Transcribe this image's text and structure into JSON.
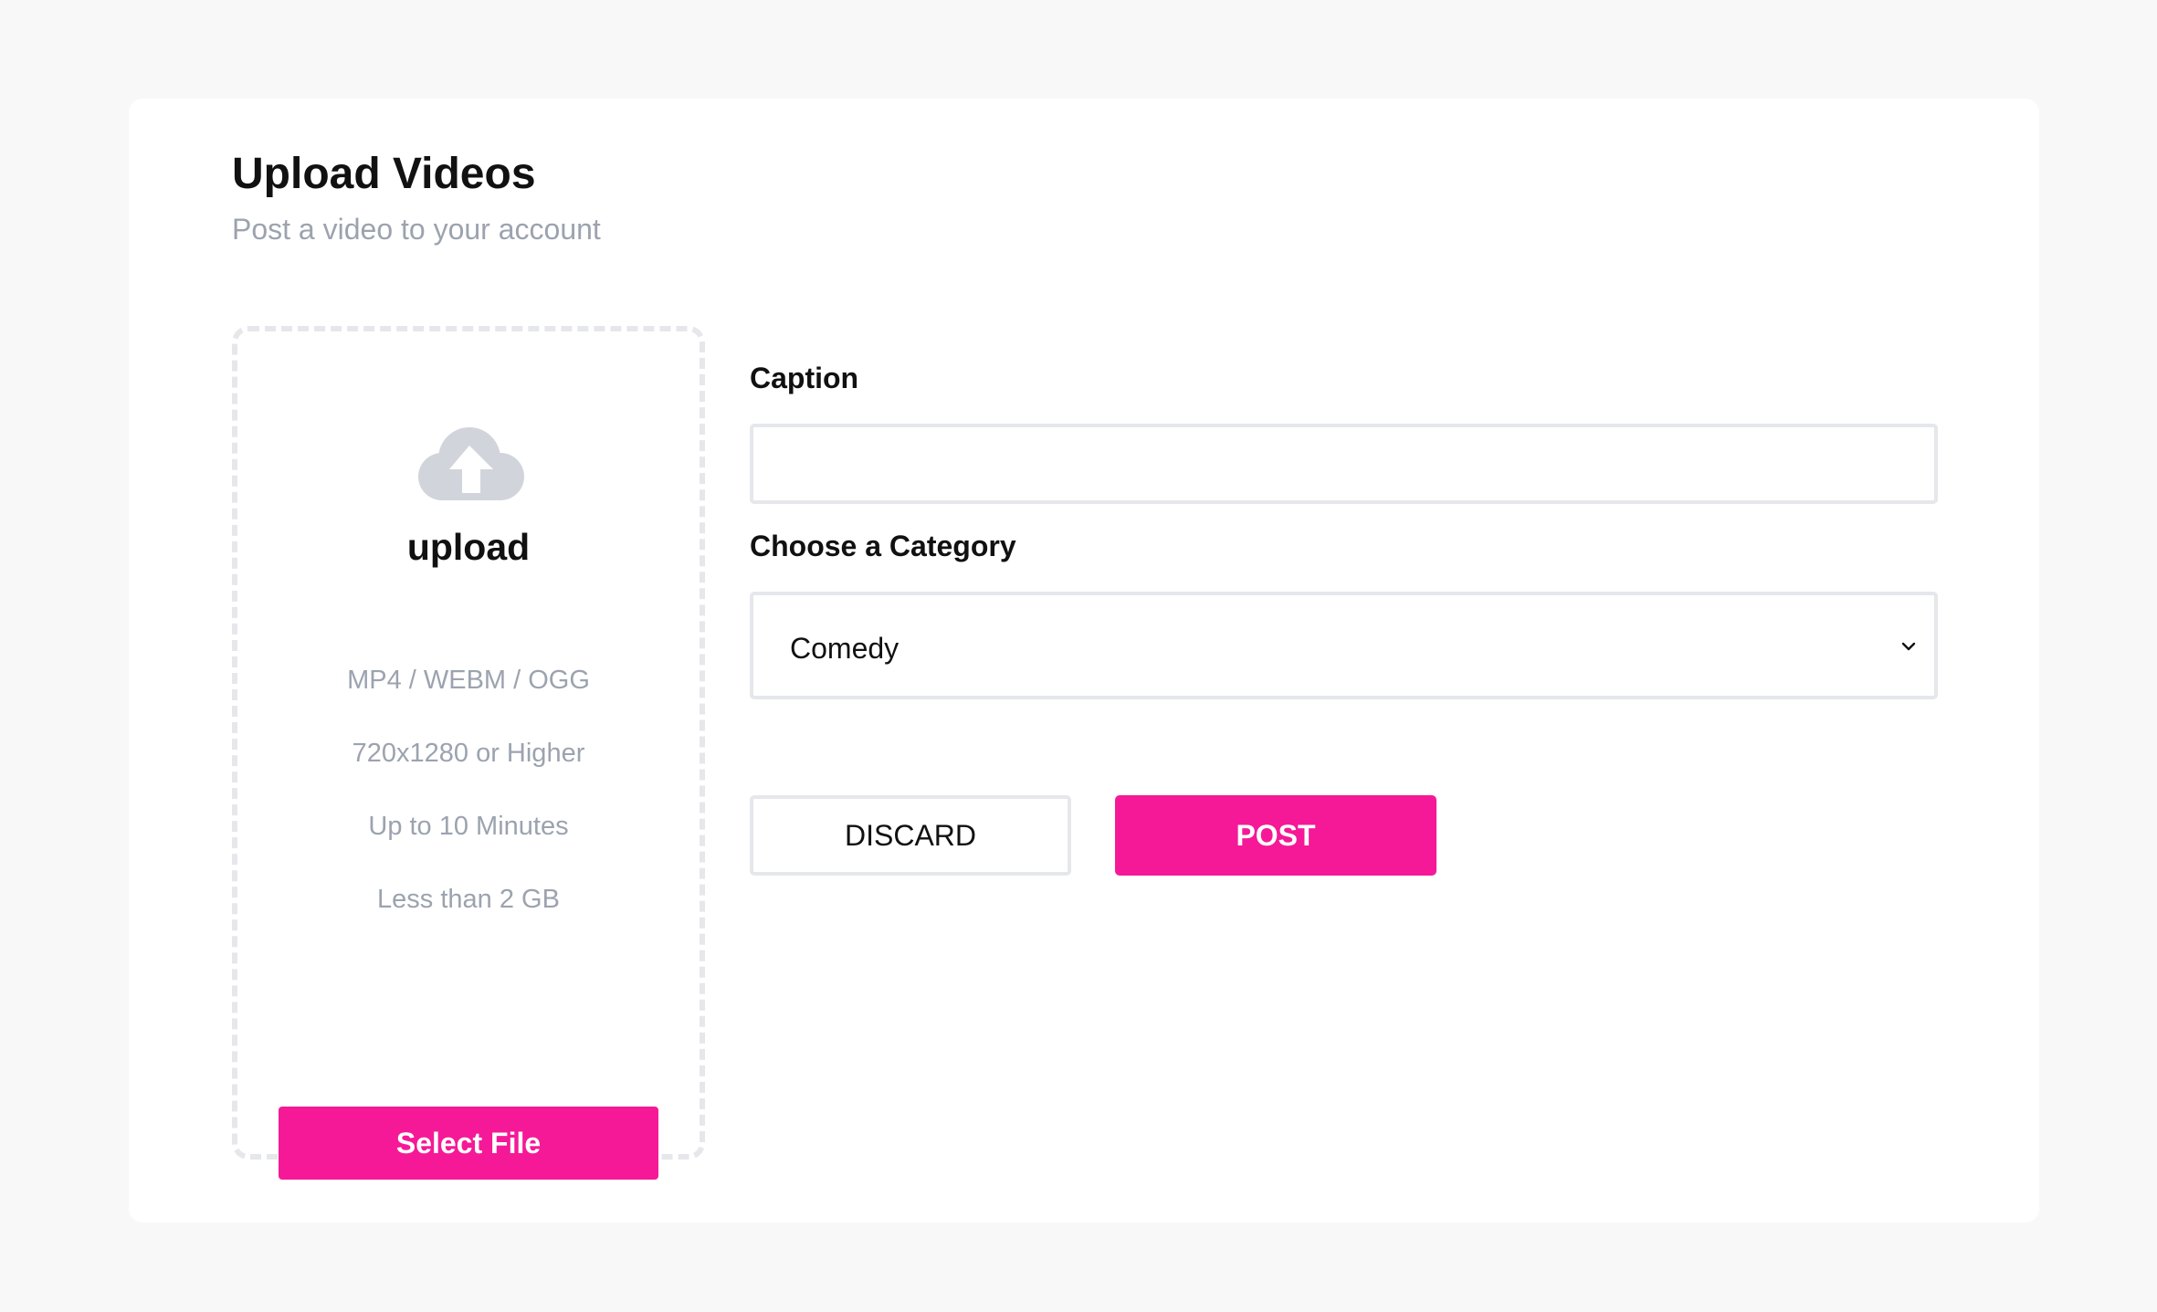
{
  "header": {
    "title": "Upload Videos",
    "subtitle": "Post a video to your account"
  },
  "upload": {
    "icon": "cloud-upload-icon",
    "label": "upload",
    "specs": [
      "MP4 / WEBM / OGG",
      "720x1280 or Higher",
      "Up to 10 Minutes",
      "Less than 2 GB"
    ],
    "select_file_label": "Select File"
  },
  "form": {
    "caption_label": "Caption",
    "caption_value": "",
    "category_label": "Choose a Category",
    "category_selected": "Comedy"
  },
  "actions": {
    "discard_label": "DISCARD",
    "post_label": "POST"
  },
  "colors": {
    "accent": "#f51997",
    "page_background": "#f8f8f8",
    "card_background": "#ffffff",
    "muted_text": "#9ca3af",
    "border": "#e5e7eb",
    "icon_gray": "#d1d5db"
  }
}
